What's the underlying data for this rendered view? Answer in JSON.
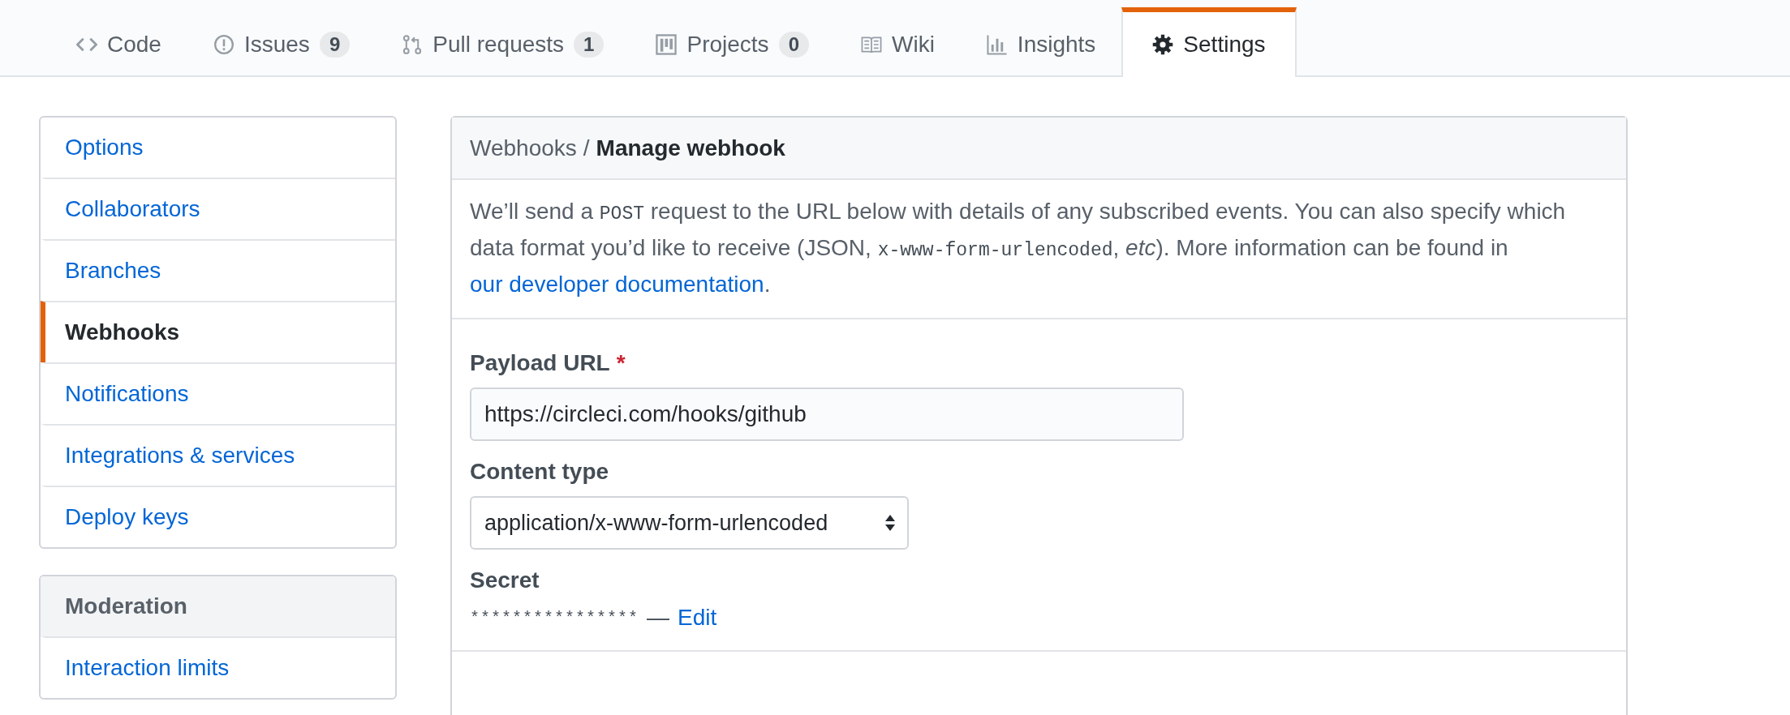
{
  "tabs": [
    {
      "label": "Code",
      "kind": "code",
      "selected": false
    },
    {
      "label": "Issues",
      "kind": "issue",
      "counter": "9",
      "selected": false
    },
    {
      "label": "Pull requests",
      "kind": "pull",
      "counter": "1",
      "selected": false
    },
    {
      "label": "Projects",
      "kind": "project",
      "counter": "0",
      "selected": false
    },
    {
      "label": "Wiki",
      "kind": "book",
      "selected": false
    },
    {
      "label": "Insights",
      "kind": "graph",
      "selected": false
    },
    {
      "label": "Settings",
      "kind": "gear",
      "selected": true
    }
  ],
  "sidebar": {
    "items": [
      {
        "label": "Options",
        "selected": false
      },
      {
        "label": "Collaborators",
        "selected": false
      },
      {
        "label": "Branches",
        "selected": false
      },
      {
        "label": "Webhooks",
        "selected": true
      },
      {
        "label": "Notifications",
        "selected": false
      },
      {
        "label": "Integrations & services",
        "selected": false
      },
      {
        "label": "Deploy keys",
        "selected": false
      }
    ],
    "groups": [
      {
        "title": "Moderation",
        "items": [
          {
            "label": "Interaction limits",
            "selected": false
          }
        ]
      }
    ]
  },
  "panel": {
    "breadcrumb": {
      "parent": "Webhooks",
      "separator": "/",
      "current": "Manage webhook"
    },
    "description": [
      {
        "kind": "text",
        "text": "We’ll send a "
      },
      {
        "kind": "code",
        "text": "POST"
      },
      {
        "kind": "text",
        "text": " request to the URL below with details of any subscribed events. You can also specify which data format you’d like to receive (JSON, "
      },
      {
        "kind": "code",
        "text": "x-www-form-urlencoded"
      },
      {
        "kind": "text",
        "text": ", *etc*). More information can be found in "
      },
      {
        "kind": "link",
        "text": "our developer documentation"
      },
      {
        "kind": "text",
        "text": "."
      }
    ],
    "fields": [
      {
        "kind": "input",
        "label": "Payload URL",
        "required_mark": "*",
        "value": "https://circleci.com/hooks/github"
      },
      {
        "kind": "select",
        "label": "Content type",
        "value": "application/x-www-form-urlencoded"
      },
      {
        "kind": "secret",
        "label": "Secret",
        "masked": "****************",
        "separator": "—",
        "link": "Edit"
      }
    ]
  }
}
